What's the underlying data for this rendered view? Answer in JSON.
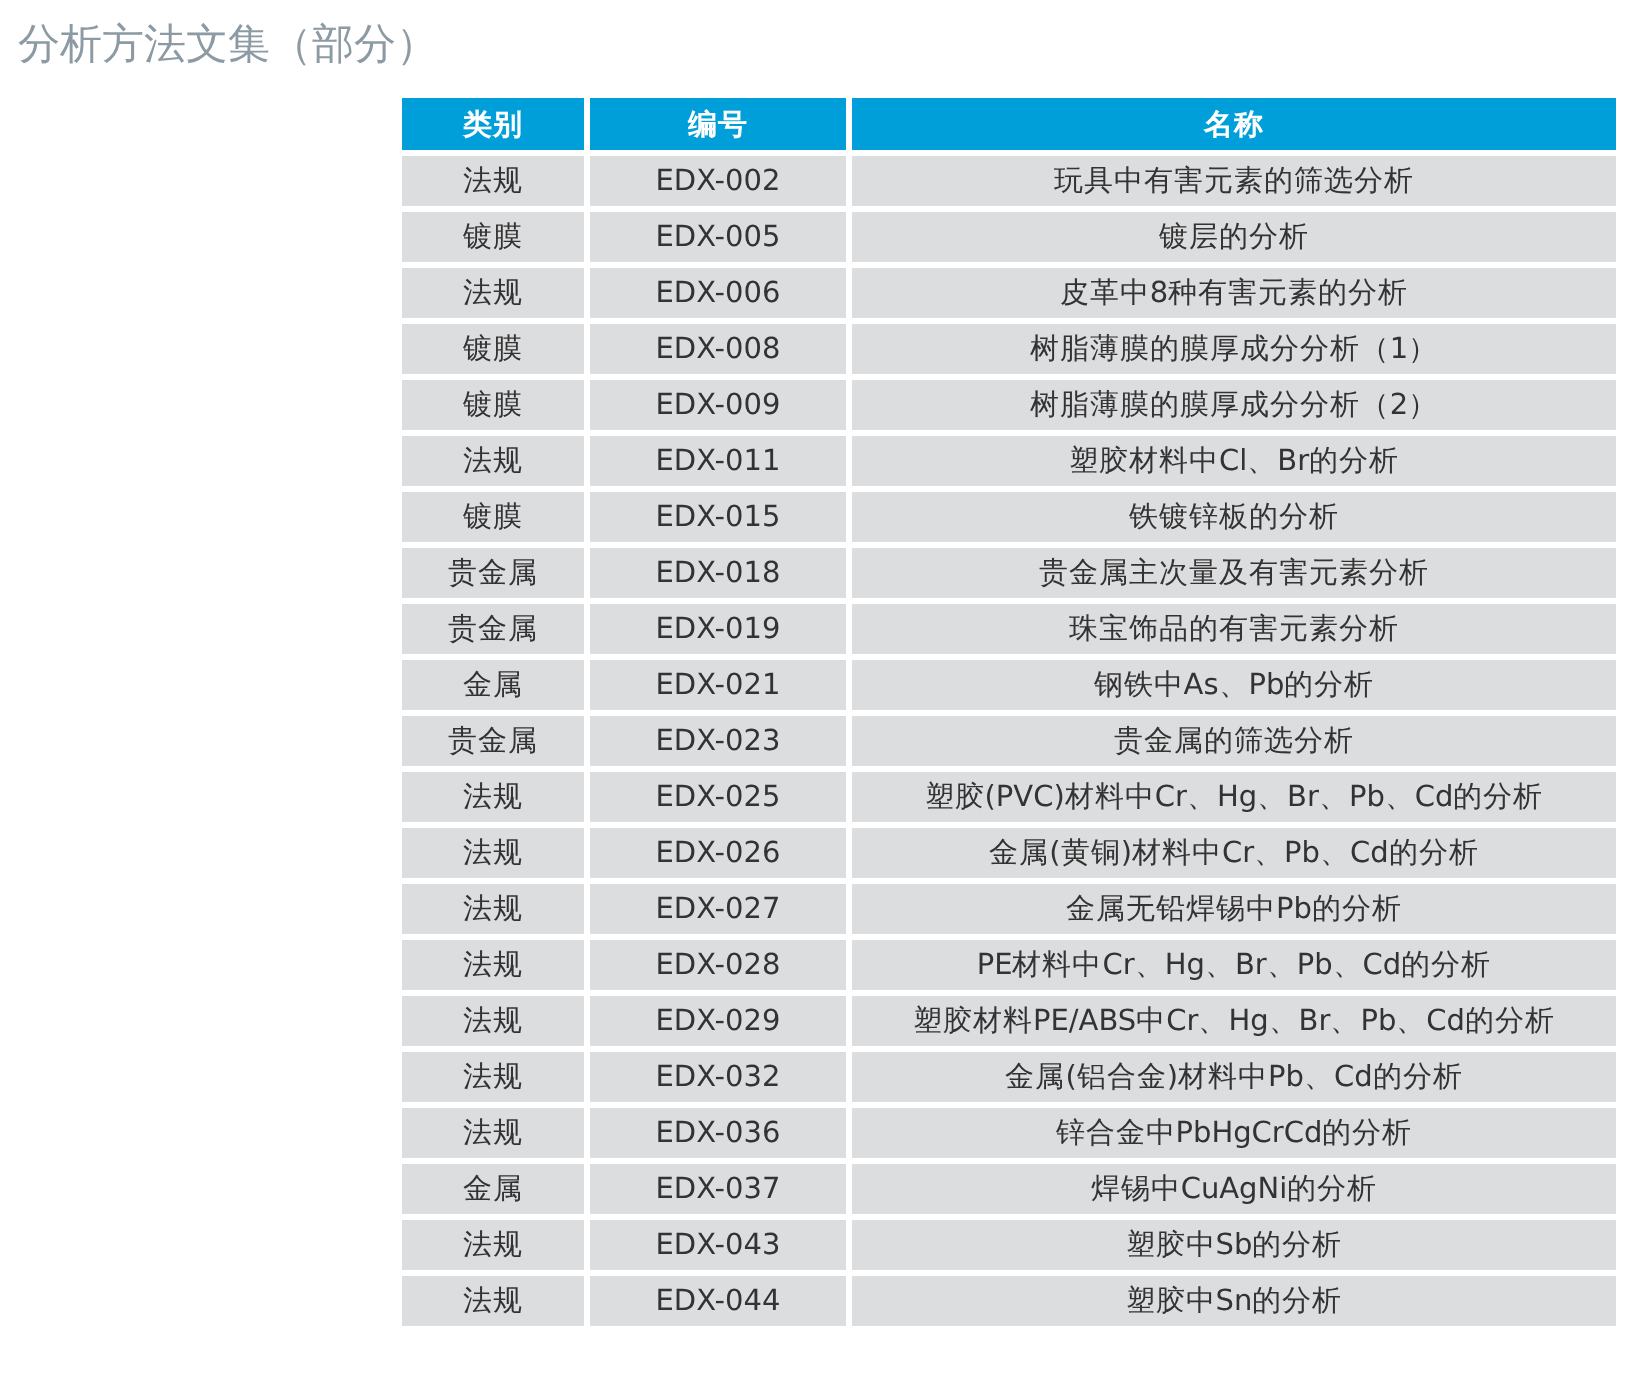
{
  "title": "分析方法文集（部分）",
  "table": {
    "columns": [
      "类别",
      "编号",
      "名称"
    ],
    "rows": [
      [
        "法规",
        "EDX-002",
        "玩具中有害元素的筛选分析"
      ],
      [
        "镀膜",
        "EDX-005",
        "镀层的分析"
      ],
      [
        "法规",
        "EDX-006",
        "皮革中8种有害元素的分析"
      ],
      [
        "镀膜",
        "EDX-008",
        "树脂薄膜的膜厚成分分析（1）"
      ],
      [
        "镀膜",
        "EDX-009",
        "树脂薄膜的膜厚成分分析（2）"
      ],
      [
        "法规",
        "EDX-011",
        "塑胶材料中Cl、Br的分析"
      ],
      [
        "镀膜",
        "EDX-015",
        "铁镀锌板的分析"
      ],
      [
        "贵金属",
        "EDX-018",
        "贵金属主次量及有害元素分析"
      ],
      [
        "贵金属",
        "EDX-019",
        "珠宝饰品的有害元素分析"
      ],
      [
        "金属",
        "EDX-021",
        "钢铁中As、Pb的分析"
      ],
      [
        "贵金属",
        "EDX-023",
        "贵金属的筛选分析"
      ],
      [
        "法规",
        "EDX-025",
        "塑胶(PVC)材料中Cr、Hg、Br、Pb、Cd的分析"
      ],
      [
        "法规",
        "EDX-026",
        "金属(黄铜)材料中Cr、Pb、Cd的分析"
      ],
      [
        "法规",
        "EDX-027",
        "金属无铅焊锡中Pb的分析"
      ],
      [
        "法规",
        "EDX-028",
        "PE材料中Cr、Hg、Br、Pb、Cd的分析"
      ],
      [
        "法规",
        "EDX-029",
        "塑胶材料PE/ABS中Cr、Hg、Br、Pb、Cd的分析"
      ],
      [
        "法规",
        "EDX-032",
        "金属(铝合金)材料中Pb、Cd的分析"
      ],
      [
        "法规",
        "EDX-036",
        "锌合金中PbHgCrCd的分析"
      ],
      [
        "金属",
        "EDX-037",
        "焊锡中CuAgNi的分析"
      ],
      [
        "法规",
        "EDX-043",
        "塑胶中Sb的分析"
      ],
      [
        "法规",
        "EDX-044",
        "塑胶中Sn的分析"
      ]
    ]
  }
}
